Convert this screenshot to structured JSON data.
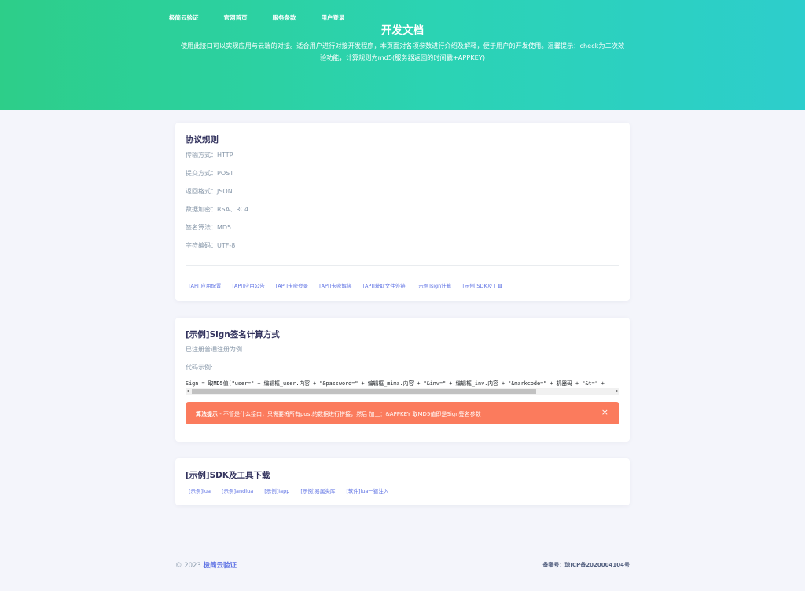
{
  "nav": {
    "items": [
      {
        "label": "极简云验证"
      },
      {
        "label": "官网首页"
      },
      {
        "label": "服务条款"
      },
      {
        "label": "用户登录"
      }
    ]
  },
  "hero": {
    "title": "开发文档",
    "desc_line1": "使用此接口可以实现应用与云端的对接。适合用户进行对接开发程序，本页面对各项参数进行介绍及解释，便于用户的开发使用。温馨提示：check为二次效",
    "desc_line2": "验功能，计算规则为md5(服务器返回的时间戳+APPKEY)"
  },
  "protocol": {
    "title": "协议规则",
    "rows": [
      {
        "text": "传输方式：HTTP"
      },
      {
        "text": "提交方式：POST"
      },
      {
        "text": "返回格式：JSON"
      },
      {
        "text": "数据加密：RSA、RC4"
      },
      {
        "text": "签名算法：MD5"
      },
      {
        "text": "字符编码：UTF-8"
      }
    ],
    "links": [
      {
        "label": "[API]应用配置"
      },
      {
        "label": "[API]应用公告"
      },
      {
        "label": "[API]卡密登录"
      },
      {
        "label": "[API]卡密解绑"
      },
      {
        "label": "[API]获取文件外链"
      },
      {
        "label": "[示例]sign计算"
      },
      {
        "label": "[示例]SDK及工具"
      }
    ]
  },
  "sign": {
    "title": "[示例]Sign签名计算方式",
    "subtitle": "已注册普通注册为例",
    "code_label": "代码示例:",
    "code": "Sign = 取MD5值(\"user=\" + 编辑框_user.内容 + \"&password=\" + 编辑框_mima.内容 + \"&inv=\" + 编辑框_inv.内容 + \"&markcode=\" + 机器码 + \"&t=\" + ",
    "alert_strong": "算法提示",
    "alert_text": " - 不管是什么接口，只需要将所有post的数据进行拼接，然后 加上：&APPKEY 取MD5值即是Sign签名参数",
    "alert_close": "×"
  },
  "sdk": {
    "title": "[示例]SDK及工具下载",
    "links": [
      {
        "label": "[示例]lua"
      },
      {
        "label": "[示例]andlua"
      },
      {
        "label": "[示例]iapp"
      },
      {
        "label": "[示例]易属类库"
      },
      {
        "label": "[软件]lua一键注入"
      }
    ]
  },
  "footer": {
    "copyright": "© 2023",
    "brand": "极简云验证",
    "icp": "备案号：琼ICP备2020004104号"
  },
  "colors": {
    "gradient_start": "#2dce89",
    "gradient_end": "#2dcecc",
    "link": "#5e72e4",
    "alert": "#fb7b5d"
  }
}
